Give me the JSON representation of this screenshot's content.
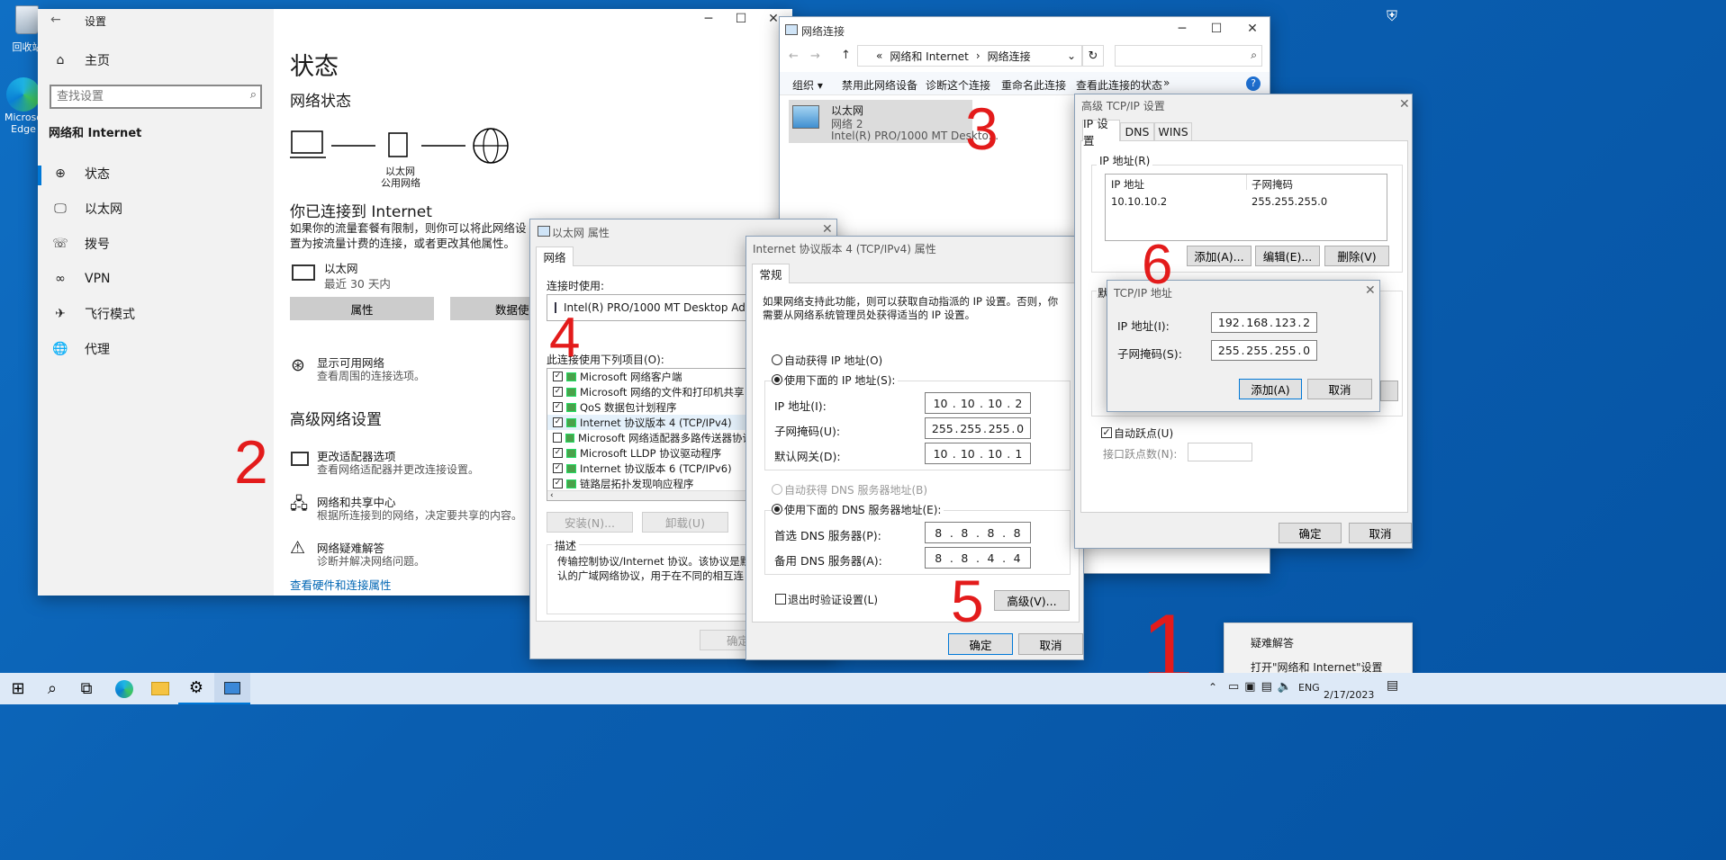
{
  "desktop": {
    "recycle_bin": "回收站",
    "edge_lines": [
      "Microso",
      "Edge"
    ]
  },
  "settings": {
    "title": "设置",
    "home": "主页",
    "search_placeholder": "查找设置",
    "section": "网络和 Internet",
    "nav": [
      "状态",
      "以太网",
      "拨号",
      "VPN",
      "飞行模式",
      "代理"
    ],
    "page_title": "状态",
    "network_status": "网络状态",
    "diagram_label1": "以太网",
    "diagram_label2": "公用网络",
    "connected_title": "你已连接到 Internet",
    "connected_desc": "如果你的流量套餐有限制，则你可以将此网络设置为按流量计费的连接，或者更改其他属性。",
    "eth_name": "以太网",
    "eth_sub": "最近 30 天内",
    "btn_properties": "属性",
    "btn_data": "数据使用量",
    "show_networks_title": "显示可用网络",
    "show_networks_desc": "查看周围的连接选项。",
    "advanced_title": "高级网络设置",
    "adv_items": [
      {
        "title": "更改适配器选项",
        "desc": "查看网络适配器并更改连接设置。"
      },
      {
        "title": "网络和共享中心",
        "desc": "根据所连接到的网络，决定要共享的内容。"
      },
      {
        "title": "网络疑难解答",
        "desc": "诊断并解决网络问题。"
      }
    ],
    "link": "查看硬件和连接属性"
  },
  "netconn": {
    "title": "网络连接",
    "breadcrumb_prefix": "«",
    "crumb1": "网络和 Internet",
    "crumb2": "网络连接",
    "toolbar": [
      "组织 ▾",
      "禁用此网络设备",
      "诊断这个连接",
      "重命名此连接",
      "查看此连接的状态",
      "»"
    ],
    "adapter_name": "以太网",
    "adapter_net": "网络 2",
    "adapter_dev": "Intel(R) PRO/1000 MT Deskto..."
  },
  "ethprops": {
    "title": "以太网 属性",
    "tab": "网络",
    "connect_using": "连接时使用:",
    "adapter": "Intel(R) PRO/1000 MT Desktop Adapter",
    "items_label": "此连接使用下列项目(O):",
    "items": [
      {
        "label": "Microsoft 网络客户端",
        "checked": true
      },
      {
        "label": "Microsoft 网络的文件和打印机共享",
        "checked": true
      },
      {
        "label": "QoS 数据包计划程序",
        "checked": true
      },
      {
        "label": "Internet 协议版本 4 (TCP/IPv4)",
        "checked": true
      },
      {
        "label": "Microsoft 网络适配器多路传送器协议",
        "checked": false
      },
      {
        "label": "Microsoft LLDP 协议驱动程序",
        "checked": true
      },
      {
        "label": "Internet 协议版本 6 (TCP/IPv6)",
        "checked": true
      },
      {
        "label": "链路层拓扑发现响应程序",
        "checked": true
      }
    ],
    "btn_install": "安装(N)...",
    "btn_uninstall": "卸载(U)",
    "desc_label": "描述",
    "desc_text": "传输控制协议/Internet 协议。该协议是默认的广域网络协议，用于在不同的相互连接的网络上通信。",
    "ok": "确定"
  },
  "ipv4": {
    "title": "Internet 协议版本 4 (TCP/IPv4) 属性",
    "tab": "常规",
    "intro": "如果网络支持此功能，则可以获取自动指派的 IP 设置。否则，你需要从网络系统管理员处获得适当的 IP 设置。",
    "auto_ip": "自动获得 IP 地址(O)",
    "use_ip": "使用下面的 IP 地址(S):",
    "ip_label": "IP 地址(I):",
    "ip": [
      "10",
      "10",
      "10",
      "2"
    ],
    "mask_label": "子网掩码(U):",
    "mask": [
      "255",
      "255",
      "255",
      "0"
    ],
    "gw_label": "默认网关(D):",
    "gw": [
      "10",
      "10",
      "10",
      "1"
    ],
    "auto_dns": "自动获得 DNS 服务器地址(B)",
    "use_dns": "使用下面的 DNS 服务器地址(E):",
    "dns1_label": "首选 DNS 服务器(P):",
    "dns1": [
      "8",
      "8",
      "8",
      "8"
    ],
    "dns2_label": "备用 DNS 服务器(A):",
    "dns2": [
      "8",
      "8",
      "4",
      "4"
    ],
    "validate": "退出时验证设置(L)",
    "advanced": "高级(V)...",
    "ok": "确定",
    "cancel": "取消"
  },
  "advtcp": {
    "title": "高级 TCP/IP 设置",
    "tabs": [
      "IP 设置",
      "DNS",
      "WINS"
    ],
    "ip_group": "IP 地址(R)",
    "col_ip": "IP 地址",
    "col_mask": "子网掩码",
    "row_ip": "10.10.10.2",
    "row_mask": "255.255.255.0",
    "add": "添加(A)...",
    "edit": "编辑(E)...",
    "del": "删除(V)",
    "gw_group": "默",
    "auto_metric": "自动跃点(U)",
    "metric_label": "接口跃点数(N):",
    "ok": "确定",
    "cancel": "取消"
  },
  "tcpaddr": {
    "title": "TCP/IP 地址",
    "ip_label": "IP 地址(I):",
    "ip": [
      "192",
      "168",
      "123",
      "2"
    ],
    "mask_label": "子网掩码(S):",
    "mask": [
      "255",
      "255",
      "255",
      "0"
    ],
    "add": "添加(A)",
    "cancel": "取消"
  },
  "context_menu": [
    "疑难解答",
    "打开\"网络和 Internet\"设置"
  ],
  "taskbar": {
    "lang": "ENG",
    "date": "2/17/2023"
  },
  "annotations": [
    "1",
    "2",
    "3",
    "4",
    "5",
    "6"
  ],
  "colors": {
    "accent": "#0078d7",
    "annotation": "#e31b1b",
    "desktop": "#0a5eb0"
  }
}
